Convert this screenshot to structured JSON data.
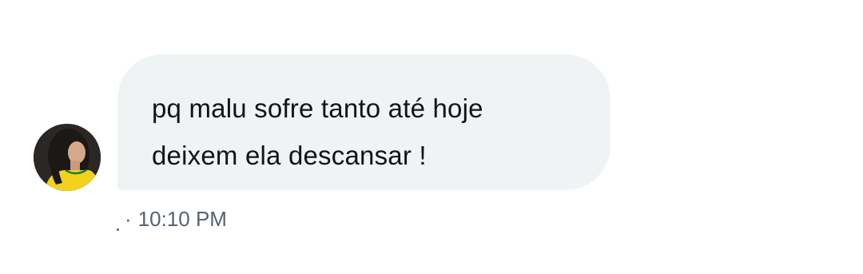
{
  "message": {
    "lines": [
      "pq malu sofre tanto até hoje",
      "deixem ela descansar !"
    ]
  },
  "meta": {
    "separator": "·",
    "time": "10:10 PM"
  },
  "colors": {
    "bubble_background": "#eff3f4",
    "message_text": "#0f1419",
    "meta_text": "#536471",
    "avatar_shirt": "#f2d21b"
  },
  "icons": {
    "avatar": "profile-photo"
  }
}
